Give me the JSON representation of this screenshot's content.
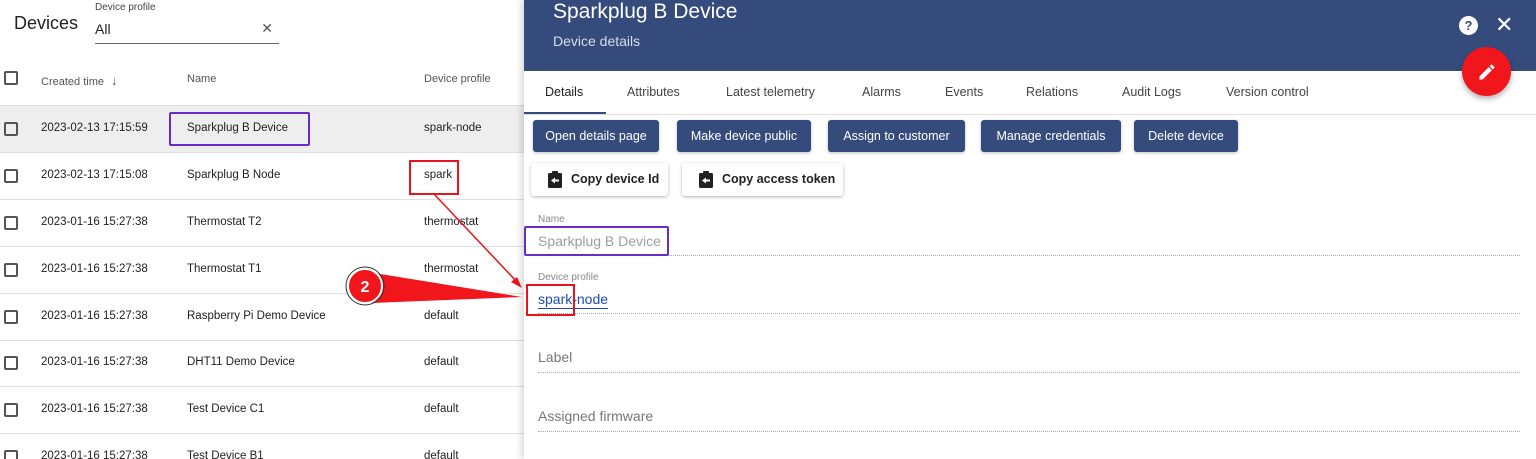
{
  "list": {
    "title": "Devices",
    "filter": {
      "label": "Device profile",
      "value": "All",
      "clear_glyph": "✕"
    },
    "columns": {
      "created": "Created time",
      "sort_glyph": "↓",
      "name": "Name",
      "profile": "Device profile"
    },
    "rows": [
      {
        "created": "2023-02-13 17:15:59",
        "name": "Sparkplug B Device",
        "profile": "spark-node",
        "selected": true
      },
      {
        "created": "2023-02-13 17:15:08",
        "name": "Sparkplug B Node",
        "profile": "spark"
      },
      {
        "created": "2023-01-16 15:27:38",
        "name": "Thermostat T2",
        "profile": "thermostat"
      },
      {
        "created": "2023-01-16 15:27:38",
        "name": "Thermostat T1",
        "profile": "thermostat"
      },
      {
        "created": "2023-01-16 15:27:38",
        "name": "Raspberry Pi Demo Device",
        "profile": "default"
      },
      {
        "created": "2023-01-16 15:27:38",
        "name": "DHT11 Demo Device",
        "profile": "default"
      },
      {
        "created": "2023-01-16 15:27:38",
        "name": "Test Device C1",
        "profile": "default"
      },
      {
        "created": "2023-01-16 15:27:38",
        "name": "Test Device B1",
        "profile": "default"
      }
    ]
  },
  "details": {
    "title": "Sparkplug B Device",
    "subtitle": "Device details",
    "help_glyph": "?",
    "close_glyph": "✕",
    "tabs": [
      "Details",
      "Attributes",
      "Latest telemetry",
      "Alarms",
      "Events",
      "Relations",
      "Audit Logs",
      "Version control"
    ],
    "actions": [
      "Open details page",
      "Make device public",
      "Assign to customer",
      "Manage credentials",
      "Delete device"
    ],
    "copy_actions": [
      "Copy device Id",
      "Copy access token"
    ],
    "fields": {
      "name_label": "Name",
      "name_value": "Sparkplug B Device",
      "profile_label": "Device profile",
      "profile_value": "spark-node",
      "label_placeholder": "Label",
      "firmware_placeholder": "Assigned firmware"
    }
  },
  "annotation": {
    "step": "2"
  },
  "colors": {
    "header": "#354b7c",
    "accent": "#f0161c",
    "highlight_purple": "#6a2bc9",
    "highlight_red": "#e8141b",
    "link": "#1c4ab8"
  },
  "icons": [
    "arrow-down-icon",
    "clear-icon",
    "help-icon",
    "close-icon",
    "edit-icon",
    "clipboard-icon"
  ]
}
